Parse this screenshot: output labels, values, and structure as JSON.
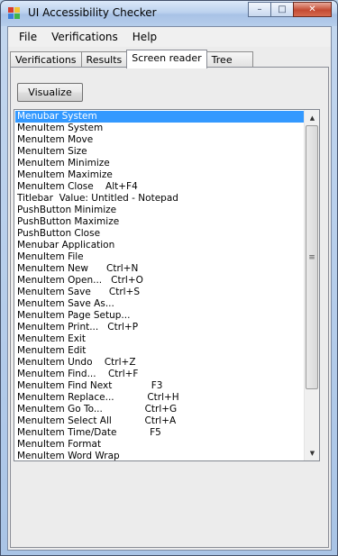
{
  "window": {
    "title": "UI Accessibility Checker",
    "buttons": {
      "minimize": "–",
      "maximize": "□",
      "close": "✕"
    }
  },
  "menu": [
    "File",
    "Verifications",
    "Help"
  ],
  "tabs": [
    {
      "label": "Verifications",
      "active": false
    },
    {
      "label": "Results",
      "active": false
    },
    {
      "label": "Screen reader",
      "active": true
    },
    {
      "label": "Tree",
      "active": false
    }
  ],
  "visualize_label": "Visualize",
  "list": {
    "selected_index": 0,
    "items": [
      "Menubar System",
      "MenuItem System",
      "MenuItem Move",
      "MenuItem Size",
      "MenuItem Minimize",
      "MenuItem Maximize",
      "MenuItem Close    Alt+F4",
      "Titlebar  Value: Untitled - Notepad",
      "PushButton Minimize",
      "PushButton Maximize",
      "PushButton Close",
      "Menubar Application",
      "MenuItem File",
      "MenuItem New      Ctrl+N",
      "MenuItem Open...   Ctrl+O",
      "MenuItem Save      Ctrl+S",
      "MenuItem Save As...",
      "MenuItem Page Setup...",
      "MenuItem Print...   Ctrl+P",
      "MenuItem Exit",
      "MenuItem Edit",
      "MenuItem Undo    Ctrl+Z",
      "MenuItem Find...    Ctrl+F",
      "MenuItem Find Next             F3",
      "MenuItem Replace...           Ctrl+H",
      "MenuItem Go To...              Ctrl+G",
      "MenuItem Select All           Ctrl+A",
      "MenuItem Time/Date           F5",
      "MenuItem Format",
      "MenuItem Word Wrap"
    ]
  },
  "scroll": {
    "up": "▲",
    "down": "▼",
    "grip": "≡"
  }
}
